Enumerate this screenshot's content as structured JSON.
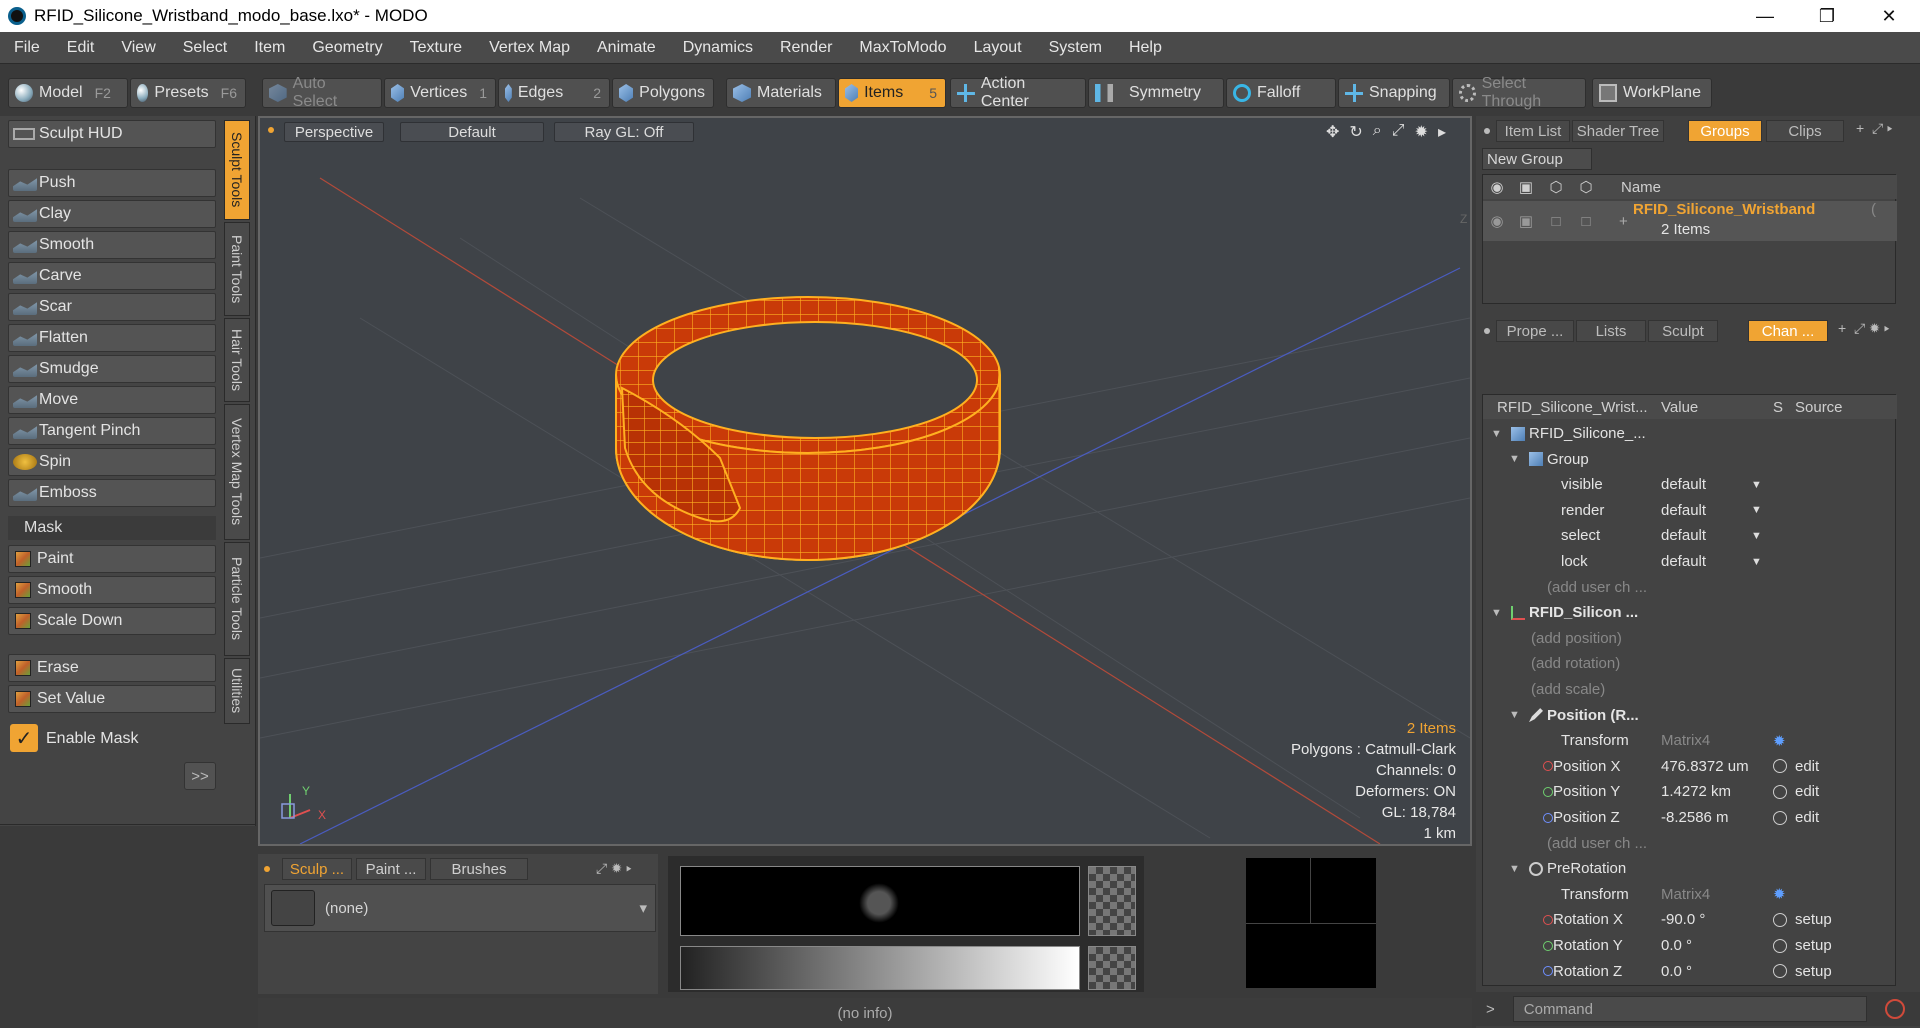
{
  "window": {
    "title": "RFID_Silicone_Wristband_modo_base.lxo* - MODO",
    "min": "—",
    "max": "❐",
    "close": "✕"
  },
  "menu": [
    "File",
    "Edit",
    "View",
    "Select",
    "Item",
    "Geometry",
    "Texture",
    "Vertex Map",
    "Animate",
    "Dynamics",
    "Render",
    "MaxToModo",
    "Layout",
    "System",
    "Help"
  ],
  "toolbar": {
    "model": "Model",
    "model_key": "F2",
    "presets": "Presets",
    "presets_key": "F6",
    "auto_select": "Auto Select",
    "vertices": "Vertices",
    "vertices_key": "1",
    "edges": "Edges",
    "edges_key": "2",
    "polygons": "Polygons",
    "materials": "Materials",
    "items": "Items",
    "items_key": "5",
    "action_center": "Action Center",
    "symmetry": "Symmetry",
    "falloff": "Falloff",
    "snapping": "Snapping",
    "select_through": "Select Through",
    "workplane": "WorkPlane"
  },
  "sculpt": {
    "hud": "Sculpt HUD",
    "tools": [
      "Push",
      "Clay",
      "Smooth",
      "Carve",
      "Scar",
      "Flatten",
      "Smudge",
      "Move",
      "Tangent Pinch",
      "Spin",
      "Emboss"
    ],
    "mask_header": "Mask",
    "mask_tools": [
      "Paint",
      "Smooth",
      "Scale Down"
    ],
    "value_tools": [
      "Erase",
      "Set Value"
    ],
    "enable_mask": "Enable Mask",
    "enable_mask_checked": true,
    "more": ">>"
  },
  "vertical_tabs": [
    "Sculpt Tools",
    "Paint Tools",
    "Hair Tools",
    "Vertex Map Tools",
    "Particle Tools",
    "Utilities"
  ],
  "viewport": {
    "view": "Perspective",
    "shading": "Default",
    "raygl": "Ray GL: Off",
    "info": {
      "items": "2 Items",
      "polygons": "Polygons : Catmull-Clark",
      "channels": "Channels: 0",
      "deformers": "Deformers: ON",
      "gl": "GL: 18,784",
      "scale": "1 km"
    },
    "axis_y": "Y",
    "axis_x": "X",
    "axis_z": "Z"
  },
  "bottom": {
    "tabs": [
      "Sculp ...",
      "Paint ...",
      "Brushes"
    ],
    "brush": "(none)",
    "status": "(no info)"
  },
  "groups_panel": {
    "tabs": [
      "Item List",
      "Shader Tree",
      "Groups",
      "Clips"
    ],
    "new_group": "New Group",
    "col_name": "Name",
    "group_name": "RFID_Silicone_Wristband",
    "group_name_tail": "(",
    "group_count": "2 Items"
  },
  "channels_panel": {
    "tabs": [
      "Prope ...",
      "Lists",
      "Sculpt",
      "Chan ..."
    ],
    "headers": {
      "name": "RFID_Silicone_Wrist...",
      "value": "Value",
      "s": "S",
      "source": "Source"
    },
    "rows": [
      {
        "label": "RFID_Silicone_...",
        "value": "",
        "src": ""
      },
      {
        "label": "Group",
        "value": "",
        "src": ""
      },
      {
        "label": "visible",
        "value": "default",
        "src": ""
      },
      {
        "label": "render",
        "value": "default",
        "src": ""
      },
      {
        "label": "select",
        "value": "default",
        "src": ""
      },
      {
        "label": "lock",
        "value": "default",
        "src": ""
      },
      {
        "label": "(add user ch ...",
        "value": "",
        "src": ""
      },
      {
        "label": "RFID_Silicon ...",
        "value": "",
        "src": ""
      },
      {
        "label": "(add position)",
        "value": "",
        "src": ""
      },
      {
        "label": "(add rotation)",
        "value": "",
        "src": ""
      },
      {
        "label": "(add scale)",
        "value": "",
        "src": ""
      },
      {
        "label": "Position (R...",
        "value": "",
        "src": ""
      },
      {
        "label": "Transform",
        "value": "Matrix4",
        "src": ""
      },
      {
        "label": "Position X",
        "value": "476.8372 um",
        "src": "edit"
      },
      {
        "label": "Position Y",
        "value": "1.4272 km",
        "src": "edit"
      },
      {
        "label": "Position Z",
        "value": "-8.2586 m",
        "src": "edit"
      },
      {
        "label": "(add user ch ...",
        "value": "",
        "src": ""
      },
      {
        "label": "PreRotation",
        "value": "",
        "src": ""
      },
      {
        "label": "Transform",
        "value": "Matrix4",
        "src": ""
      },
      {
        "label": "Rotation X",
        "value": "-90.0 °",
        "src": "setup"
      },
      {
        "label": "Rotation Y",
        "value": "0.0 °",
        "src": "setup"
      },
      {
        "label": "Rotation Z",
        "value": "0.0 °",
        "src": "setup"
      }
    ]
  },
  "command": {
    "placeholder": "Command"
  },
  "colors": {
    "accent": "#f0a433",
    "mesh": "#c93a08",
    "wire": "#ffb020"
  }
}
